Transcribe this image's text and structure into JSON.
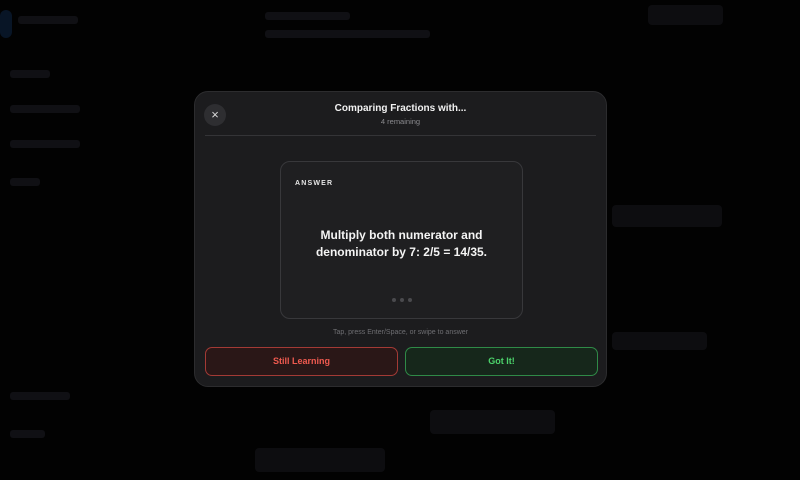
{
  "modal": {
    "title": "Comparing Fractions with...",
    "subtitle": "4 remaining",
    "close_icon": "×"
  },
  "card": {
    "label": "ANSWER",
    "text": "Multiply both numerator and denominator by 7: 2/5 = 14/35."
  },
  "hint": "Tap, press Enter/Space, or swipe to answer",
  "buttons": {
    "still_learning": "Still Learning",
    "got_it": "Got It!"
  },
  "colors": {
    "danger": "#ef5a4f",
    "success": "#4cd26b",
    "surface": "#1c1c1e"
  }
}
